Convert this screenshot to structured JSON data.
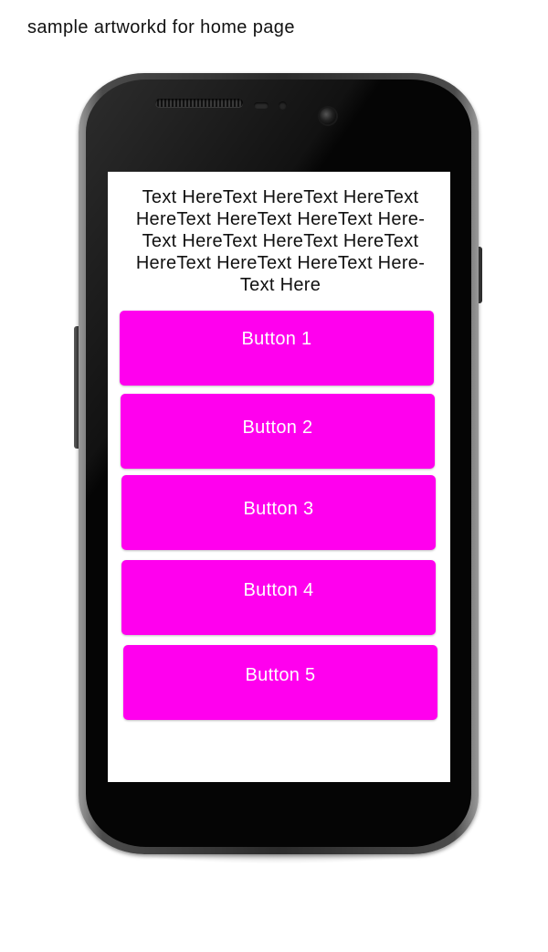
{
  "caption": "sample artworkd for home page",
  "screen": {
    "text": "Text HereText HereText HereText HereText HereText HereText Here-Text HereText HereText HereText HereText HereText HereText Here-Text Here",
    "buttons": [
      {
        "label": "Button 1"
      },
      {
        "label": "Button 2"
      },
      {
        "label": "Button 3"
      },
      {
        "label": "Button 4"
      },
      {
        "label": "Button 5"
      }
    ]
  },
  "colors": {
    "button_bg": "#ff00ee",
    "button_text": "#ffffff",
    "screen_bg": "#ffffff",
    "phone_body": "#050505"
  },
  "icons": [
    "speaker-grille",
    "proximity-sensor",
    "front-camera"
  ]
}
